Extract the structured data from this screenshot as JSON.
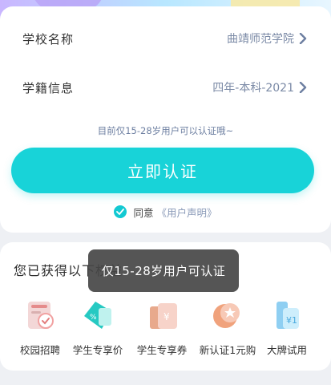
{
  "form": {
    "school_label": "学校名称",
    "school_value": "曲靖师范学院",
    "status_label": "学籍信息",
    "status_value": "四年-本科-2021",
    "hint": "目前仅15-28岁用户可以认证哦~",
    "submit_label": "立即认证",
    "agree_text": "同意",
    "agree_link": "《用户声明》"
  },
  "benefits": {
    "title": "您已获得以下权益",
    "items": [
      {
        "label": "校园招聘",
        "icon": "campus-recruit-icon"
      },
      {
        "label": "学生专享价",
        "icon": "student-price-icon"
      },
      {
        "label": "学生专享券",
        "icon": "student-coupon-icon"
      },
      {
        "label": "新认证1元购",
        "icon": "one-yuan-icon"
      },
      {
        "label": "大牌试用",
        "icon": "brand-trial-icon"
      }
    ]
  },
  "toast": {
    "message": "仅15-28岁用户可认证"
  },
  "colors": {
    "accent": "#18d3d8",
    "link": "#7b8aa6",
    "toast_bg": "#464646"
  }
}
